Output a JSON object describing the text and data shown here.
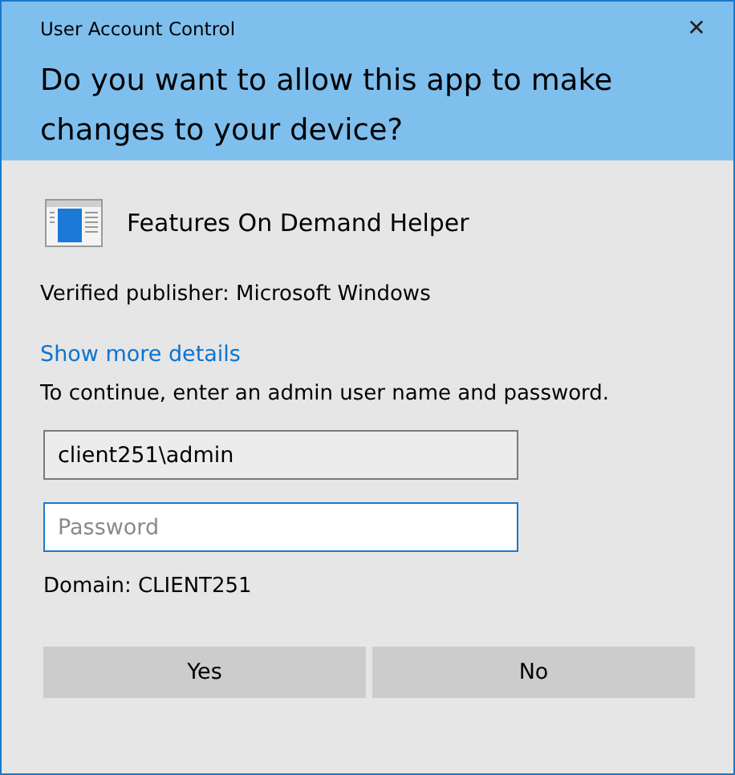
{
  "window": {
    "title": "User Account Control",
    "close": "✕"
  },
  "question": "Do you want to allow this app to make changes to your device?",
  "app": {
    "name": "Features On Demand Helper"
  },
  "publisher": "Verified publisher: Microsoft Windows",
  "details_link": "Show more details",
  "instruction": "To continue, enter an admin user name and password.",
  "fields": [
    {
      "kind": "text",
      "value": "client251\\admin",
      "focused": false
    },
    {
      "kind": "password",
      "placeholder": "Password",
      "focused": true
    }
  ],
  "domain": "Domain: CLIENT251",
  "buttons": [
    "Yes",
    "No"
  ]
}
